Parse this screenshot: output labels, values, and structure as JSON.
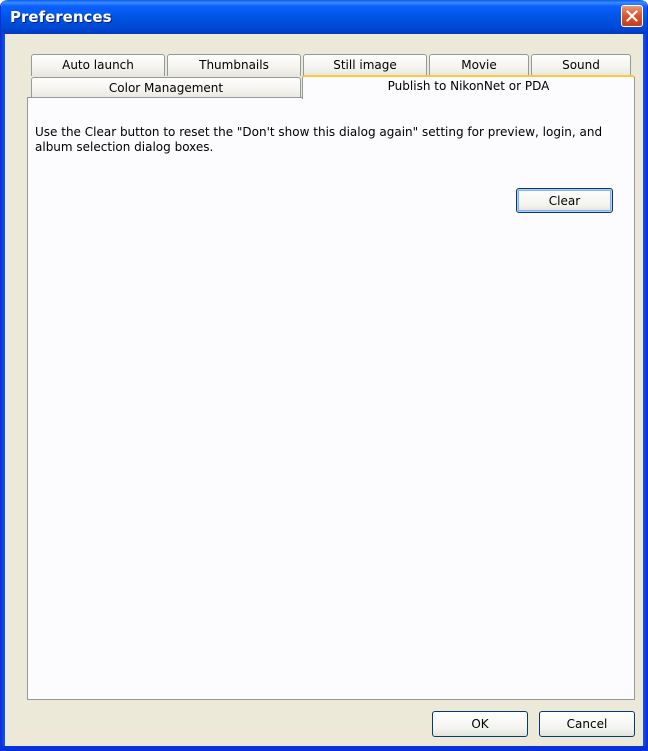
{
  "window": {
    "title": "Preferences"
  },
  "tabs": {
    "row1": [
      "Auto launch",
      "Thumbnails",
      "Still image",
      "Movie",
      "Sound"
    ],
    "row2": [
      "Color Management",
      "Publish to NikonNet or PDA"
    ],
    "active": "Publish to NikonNet or PDA"
  },
  "panel": {
    "description": "Use the Clear button to reset the \"Don't show this dialog again\" setting for preview, login, and album selection dialog boxes.",
    "clear_label": "Clear"
  },
  "footer": {
    "ok_label": "OK",
    "cancel_label": "Cancel"
  },
  "colors": {
    "titlebar": "#0055e5",
    "close_button": "#d75a34",
    "dialog_face": "#ece9d8",
    "active_tab_accent": "#ffc83c",
    "button_border": "#003c74"
  },
  "icons": {
    "close": "close-icon"
  }
}
